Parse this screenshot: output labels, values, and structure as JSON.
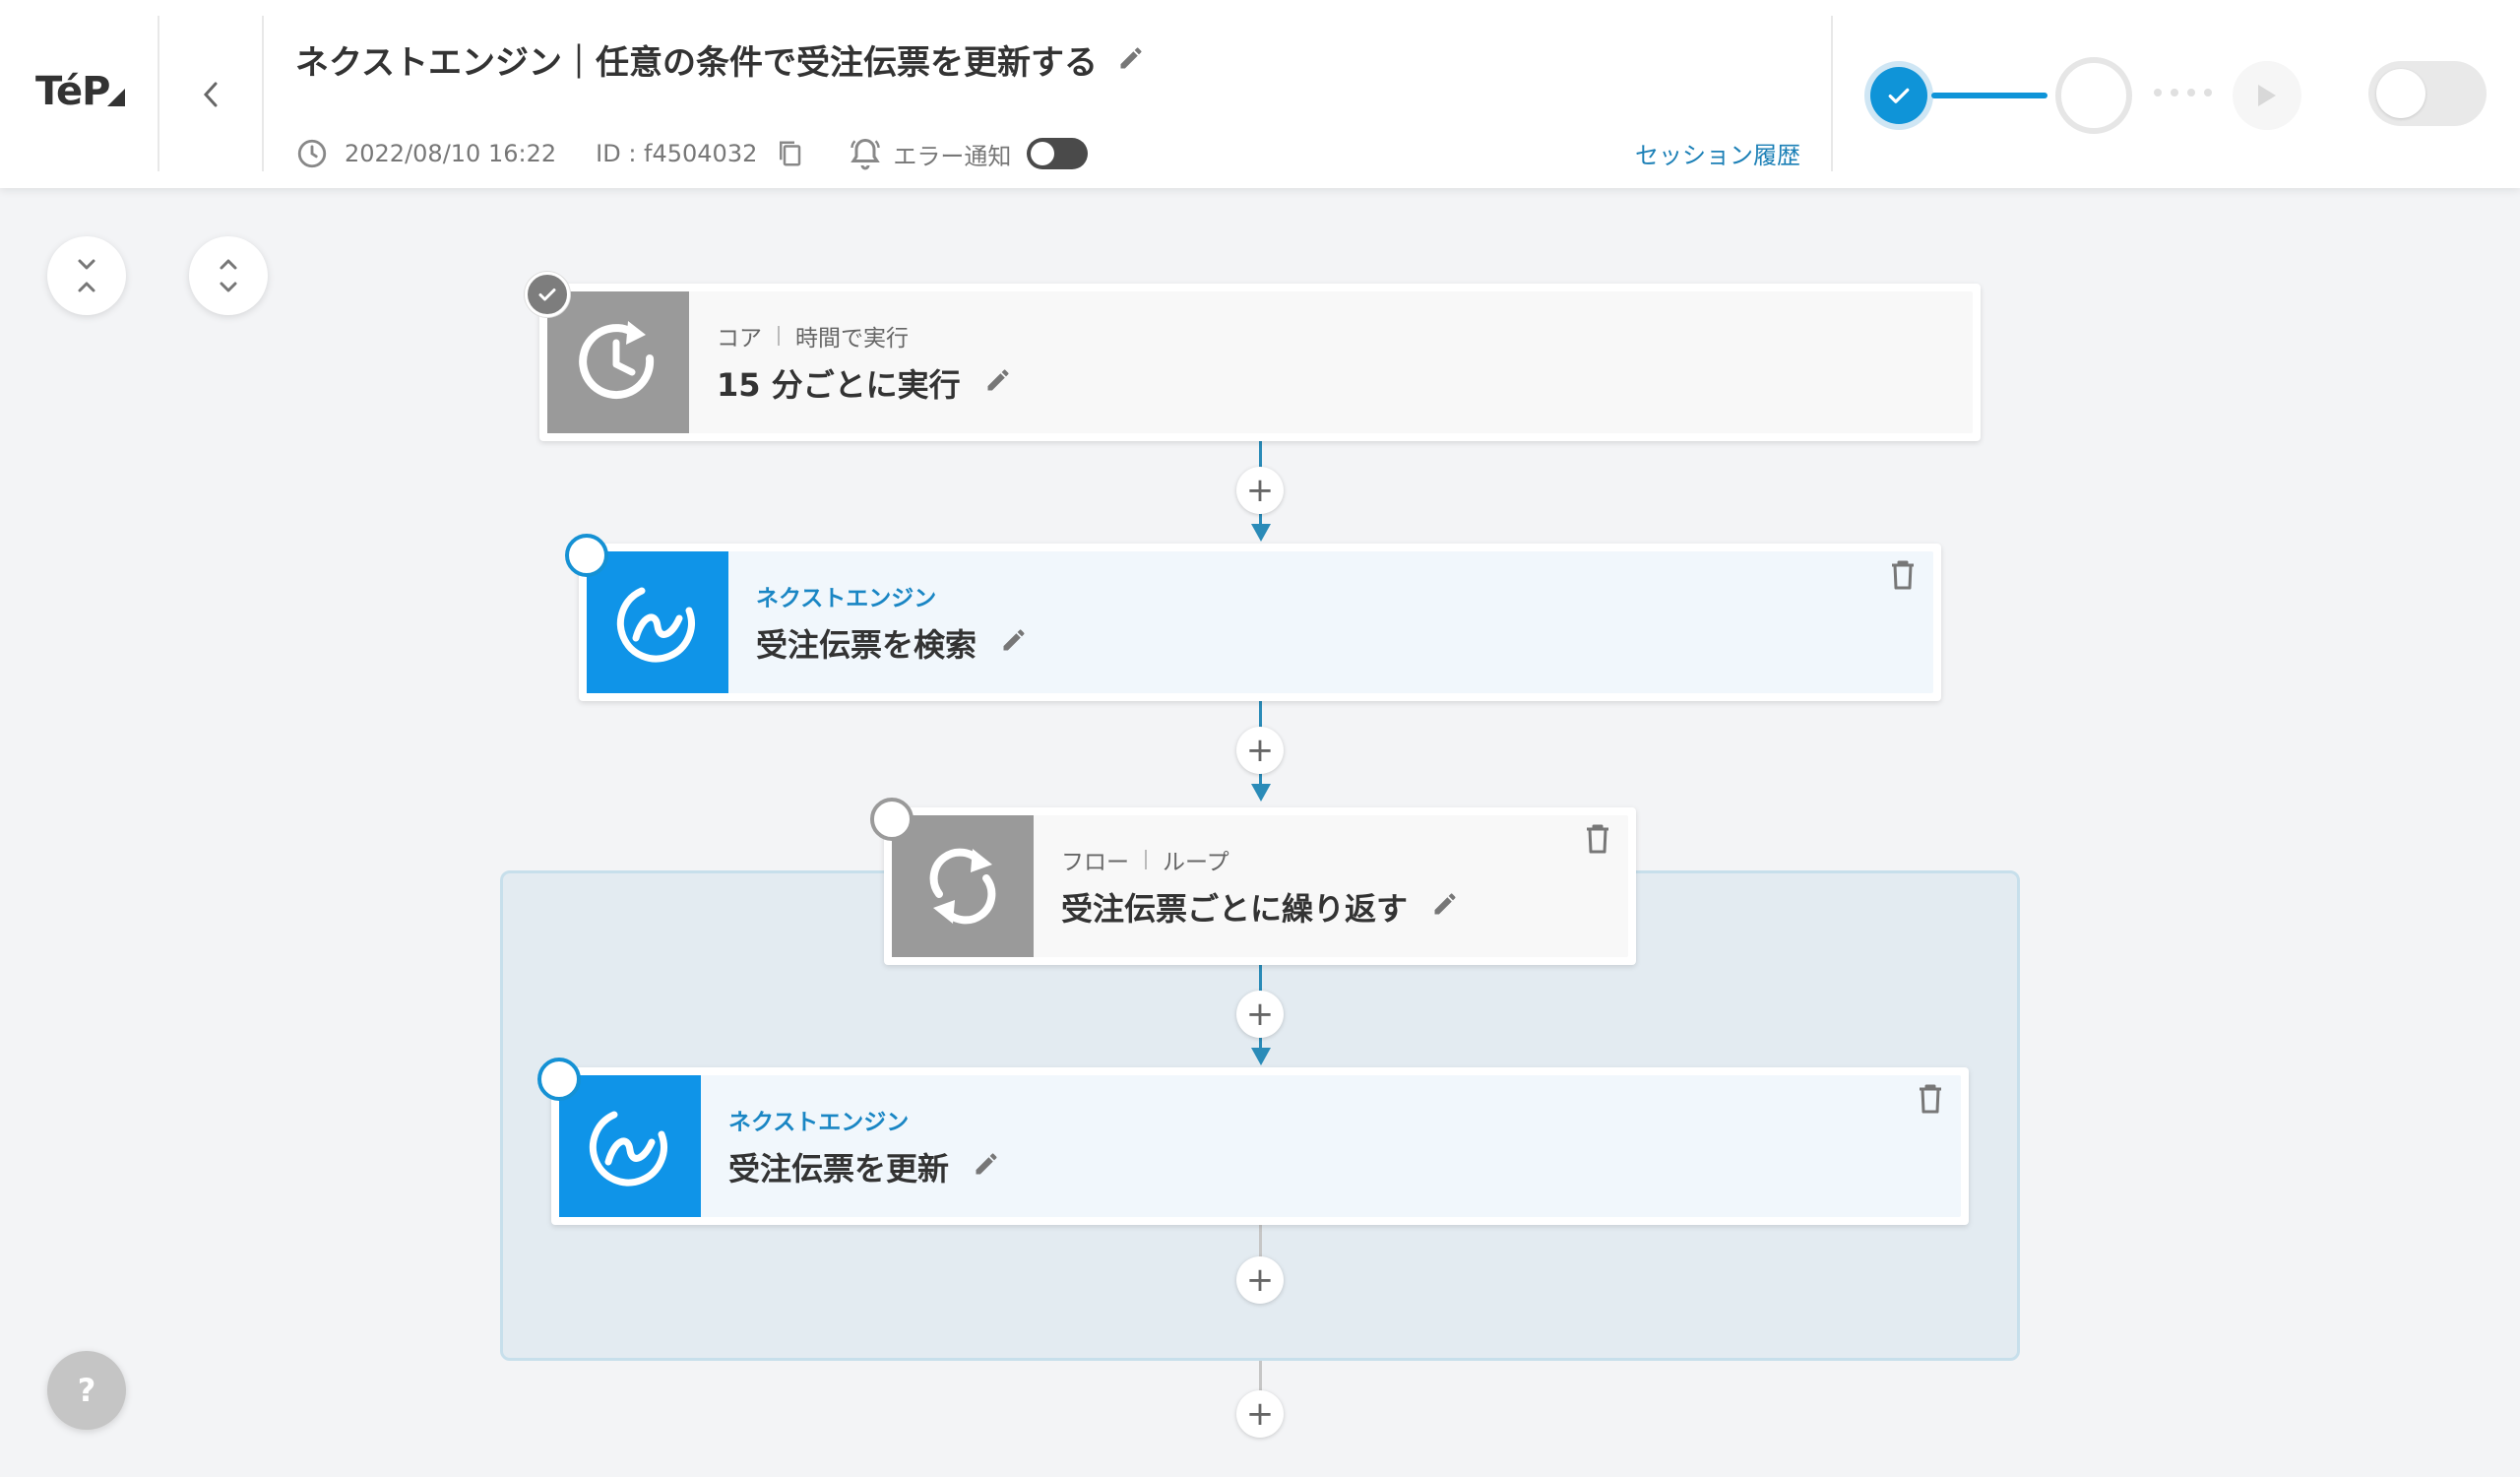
{
  "header": {
    "logo": "TéP",
    "title": "ネクストエンジン｜任意の条件で受注伝票を更新する",
    "datetime": "2022/08/10 16:22",
    "id_label": "ID : f4504032",
    "error_notify_label": "エラー通知",
    "session_history_label": "セッション履歴"
  },
  "help": {
    "label": "?"
  },
  "flow": {
    "steps": [
      {
        "category": "コア",
        "subcategory": "時間で実行",
        "title": "15 分ごとに実行",
        "icon": "clock-rotate-icon",
        "status": "done"
      },
      {
        "category": "ネクストエンジン",
        "title": "受注伝票を検索",
        "icon": "nextengine-icon",
        "status": "pending"
      },
      {
        "category": "フロー",
        "subcategory": "ループ",
        "title": "受注伝票ごとに繰り返す",
        "icon": "loop-icon",
        "status": "pending"
      },
      {
        "category": "ネクストエンジン",
        "title": "受注伝票を更新",
        "icon": "nextengine-icon",
        "status": "pending"
      }
    ],
    "add_label": "+"
  },
  "colors": {
    "accent": "#0f94d8",
    "connector": "#2a8bb8",
    "nextengine_blue": "#0f94e8",
    "core_gray": "#9a9a9a",
    "loop_region": "#e3ebf1"
  }
}
